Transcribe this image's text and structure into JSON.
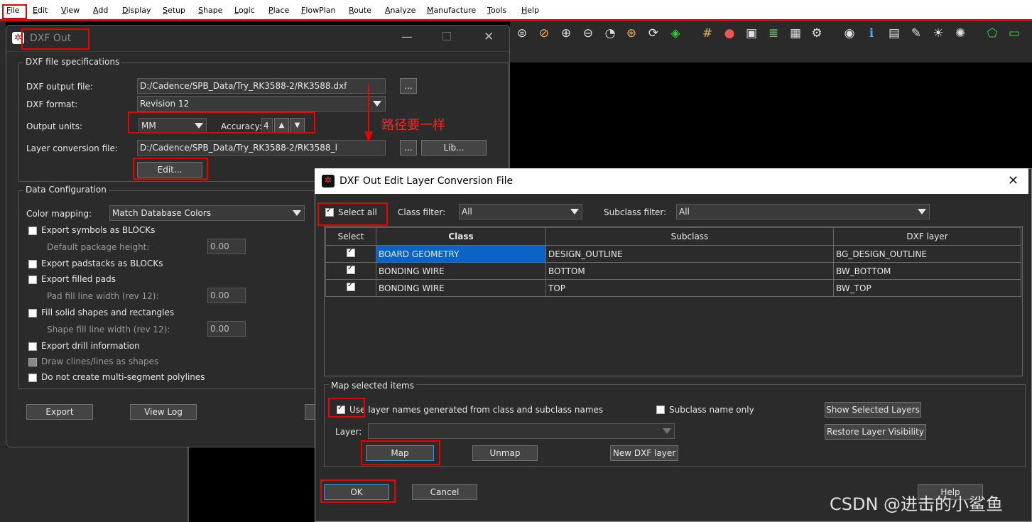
{
  "menu": [
    "File",
    "Edit",
    "View",
    "Add",
    "Display",
    "Setup",
    "Shape",
    "Logic",
    "Place",
    "FlowPlan",
    "Route",
    "Analyze",
    "Manufacture",
    "Tools",
    "Help"
  ],
  "dxf_out": {
    "title": "DXF Out",
    "spec_group": "DXF file specifications",
    "output_file_label": "DXF output file:",
    "output_file_value": "D:/Cadence/SPB_Data/Try_RK3588-2/RK3588.dxf",
    "browse_label": "...",
    "format_label": "DXF format:",
    "format_value": "Revision 12",
    "units_label": "Output units:",
    "units_value": "MM",
    "accuracy_label": "Accuracy:",
    "accuracy_value": "4",
    "layer_file_label": "Layer conversion file:",
    "layer_file_value": "D:/Cadence/SPB_Data/Try_RK3588-2/RK3588_l",
    "browse2_label": "...",
    "lib_label": "Lib...",
    "edit_label": "Edit...",
    "annotation": "路径要一样",
    "data_group": "Data Configuration",
    "color_label": "Color mapping:",
    "color_value": "Match Database Colors",
    "opt_symbols": "Export symbols as BLOCKs",
    "opt_pkg_height": "Default package height:",
    "pkg_height_value": "0.00",
    "opt_padstacks": "Export padstacks as BLOCKs",
    "opt_filled_pads": "Export filled pads",
    "opt_pad_fill": "Pad fill line width (rev 12):",
    "pad_fill_value": "0.00",
    "opt_fill_shapes": "Fill solid shapes and rectangles",
    "opt_shape_fill": "Shape fill line width (rev 12):",
    "shape_fill_value": "0.00",
    "opt_drill": "Export drill information",
    "opt_clines": "Draw clines/lines as shapes",
    "opt_polylines": "Do not create multi-segment polylines",
    "export_label": "Export",
    "viewlog_label": "View Log"
  },
  "edit_layer": {
    "title": "DXF Out Edit Layer Conversion File",
    "select_all": "Select all",
    "class_filter_label": "Class filter:",
    "class_filter_value": "All",
    "subclass_filter_label": "Subclass filter:",
    "subclass_filter_value": "All",
    "columns": [
      "Select",
      "Class",
      "Subclass",
      "DXF layer"
    ],
    "rows": [
      {
        "class": "BOARD GEOMETRY",
        "subclass": "DESIGN_OUTLINE",
        "layer": "BG_DESIGN_OUTLINE"
      },
      {
        "class": "BONDING WIRE",
        "subclass": "BOTTOM",
        "layer": "BW_BOTTOM"
      },
      {
        "class": "BONDING WIRE",
        "subclass": "TOP",
        "layer": "BW_TOP"
      }
    ],
    "map_group": "Map selected items",
    "use_names": "Use layer names generated from class and subclass names",
    "subclass_only": "Subclass name only",
    "show_selected": "Show Selected Layers",
    "restore_visibility": "Restore Layer Visibility",
    "layer_label": "Layer:",
    "map_label": "Map",
    "unmap_label": "Unmap",
    "new_layer_label": "New DXF layer",
    "ok_label": "OK",
    "cancel_label": "Cancel",
    "help_label": "Help"
  },
  "watermark": "CSDN @进击的小鲨鱼"
}
